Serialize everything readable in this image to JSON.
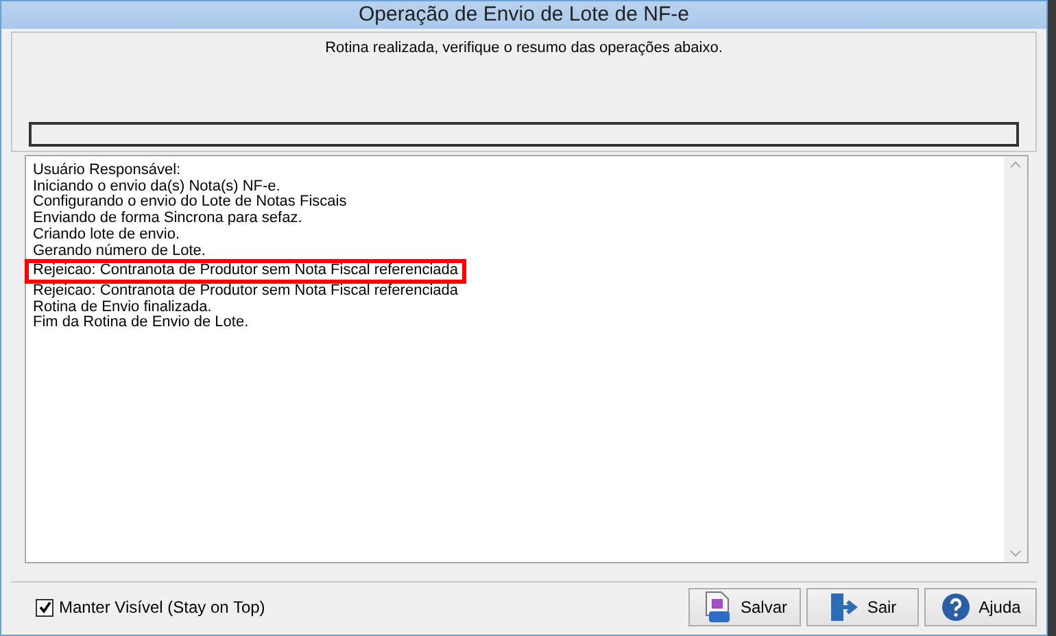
{
  "window": {
    "title": "Operação de Envio de Lote de NF-e"
  },
  "message": "Rotina realizada, verifique o resumo das operações abaixo.",
  "log": [
    {
      "text": "Usuário Responsável:",
      "highlighted": false
    },
    {
      "text": "Iniciando o envio da(s) Nota(s) NF-e.",
      "highlighted": false
    },
    {
      "text": "Configurando o envio do Lote de Notas Fiscais",
      "highlighted": false
    },
    {
      "text": "Enviando de forma Sincrona para sefaz.",
      "highlighted": false
    },
    {
      "text": "Criando lote de envio.",
      "highlighted": false
    },
    {
      "text": "Gerando número de Lote.",
      "highlighted": false
    },
    {
      "text": "Rejeicao: Contranota de Produtor sem Nota Fiscal referenciada",
      "highlighted": true
    },
    {
      "text": "Rejeicao: Contranota de Produtor sem Nota Fiscal referenciada",
      "highlighted": false
    },
    {
      "text": "Rotina de Envio finalizada.",
      "highlighted": false
    },
    {
      "text": "Fim da Rotina de Envio de Lote.",
      "highlighted": false
    }
  ],
  "stay_on_top": {
    "label": "Manter Visível (Stay on Top)",
    "checked": true
  },
  "buttons": [
    {
      "kind": "save",
      "label": "Salvar"
    },
    {
      "kind": "exit",
      "label": "Sair"
    },
    {
      "kind": "help",
      "label": "Ajuda"
    }
  ]
}
